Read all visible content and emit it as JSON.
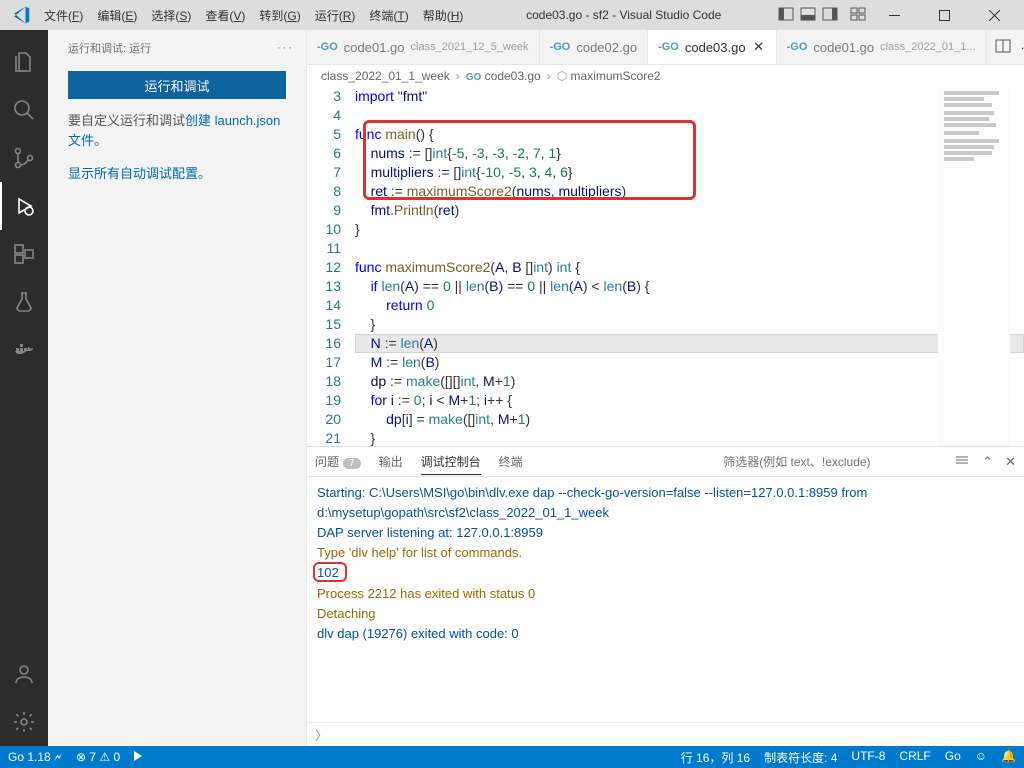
{
  "title": "code03.go - sf2 - Visual Studio Code",
  "menu": [
    "文件(F)",
    "编辑(E)",
    "选择(S)",
    "查看(V)",
    "转到(G)",
    "运行(R)",
    "终端(T)",
    "帮助(H)"
  ],
  "sidebar": {
    "section": "运行和调试: 运行",
    "button": "运行和调试",
    "line1_prefix": "要自定义运行和调试",
    "line1_link": "创建 launch.json 文件",
    "line1_suffix": "。",
    "line2": "显示所有自动调试配置。"
  },
  "tabs": [
    {
      "name": "code01.go",
      "sub": "class_2021_12_5_week",
      "active": false
    },
    {
      "name": "code02.go",
      "sub": "",
      "active": false
    },
    {
      "name": "code03.go",
      "sub": "",
      "active": true,
      "close": true
    },
    {
      "name": "code01.go",
      "sub": "class_2022_01_1...",
      "active": false
    }
  ],
  "breadcrumb": [
    "class_2022_01_1_week",
    "code03.go",
    "maximumScore2"
  ],
  "lines": [
    3,
    4,
    5,
    6,
    7,
    8,
    9,
    10,
    11,
    12,
    13,
    14,
    15,
    16,
    17,
    18,
    19,
    20,
    21
  ],
  "code": {
    "3": "import \"fmt\"",
    "4": "",
    "5": "func main() {",
    "6": "    nums := []int{-5, -3, -3, -2, 7, 1}",
    "7": "    multipliers := []int{-10, -5, 3, 4, 6}",
    "8": "    ret := maximumScore2(nums, multipliers)",
    "9": "    fmt.Println(ret)",
    "10": "}",
    "11": "",
    "12": "func maximumScore2(A, B []int) int {",
    "13": "    if len(A) == 0 || len(B) == 0 || len(A) < len(B) {",
    "14": "        return 0",
    "15": "    }",
    "16": "    N := len(A)",
    "17": "    M := len(B)",
    "18": "    dp := make([][]int, M+1)",
    "19": "    for i := 0; i < M+1; i++ {",
    "20": "        dp[i] = make([]int, M+1)",
    "21": "    }"
  },
  "panel": {
    "tabs": [
      "问题",
      "输出",
      "调试控制台",
      "终端"
    ],
    "problem_count": "7",
    "filter_placeholder": "筛选器(例如 text、!exclude)",
    "lines": [
      "Starting: C:\\Users\\MSI\\go\\bin\\dlv.exe dap --check-go-version=false --listen=127.0.0.1:8959 from d:\\mysetup\\gopath\\src\\sf2\\class_2022_01_1_week",
      "DAP server listening at: 127.0.0.1:8959",
      "Type 'dlv help' for list of commands.",
      "102",
      "Process 2212 has exited with status 0",
      "Detaching",
      "dlv dap (19276) exited with code: 0"
    ]
  },
  "status": {
    "go": "Go 1.18",
    "diag": "⊗ 7 ⚠ 0",
    "pos": "行 16，列 16",
    "tab": "制表符长度: 4",
    "enc": "UTF-8",
    "eol": "CRLF",
    "lang": "Go"
  }
}
